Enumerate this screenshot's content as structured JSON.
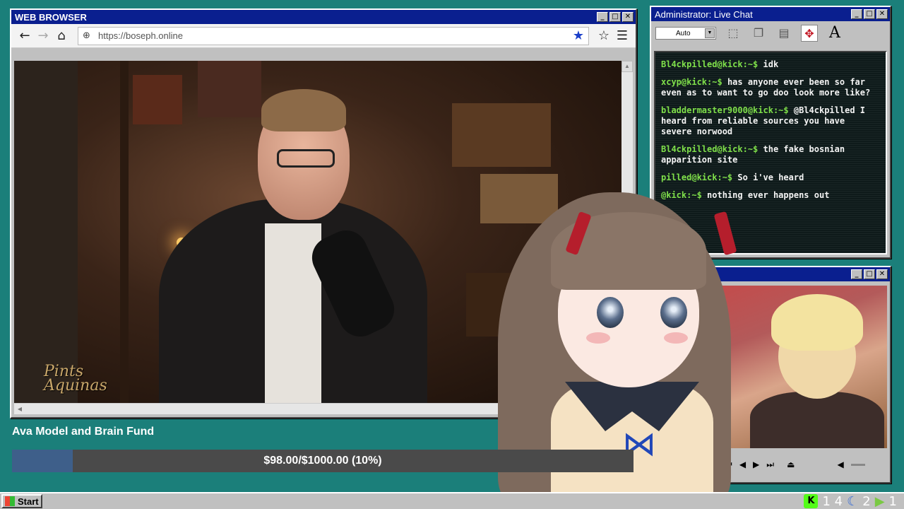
{
  "browser": {
    "title": "WEB BROWSER",
    "url": "https://boseph.online",
    "video_logo": "Pints Aquinas"
  },
  "chat": {
    "title": "Administrator: Live Chat",
    "select_value": "Auto",
    "messages": [
      {
        "user": "Bl4ckpilled@kick:~$",
        "text": "idk"
      },
      {
        "user": "xcyp@kick:~$",
        "text": "has anyone ever been so far even as to want to go doo look more like?"
      },
      {
        "user": "bladdermaster9000@kick:~$",
        "text": "@Bl4ckpilled I heard from reliable sources you have severe norwood"
      },
      {
        "user": "Bl4ckpilled@kick:~$",
        "text": "the fake bosnian apparition site"
      },
      {
        "user": "pilled@kick:~$",
        "text": "So i've heard"
      },
      {
        "user": "@kick:~$",
        "text": "nothing ever happens out"
      }
    ]
  },
  "fund": {
    "title": "Ava Model and Brain Fund",
    "progress_text": "$98.00/$1000.00 (10%)",
    "progress_fraction": 0.098
  },
  "taskbar": {
    "start_label": "Start",
    "tray_count_1": "1 4",
    "tray_count_2": "2",
    "tray_count_3": "1"
  }
}
